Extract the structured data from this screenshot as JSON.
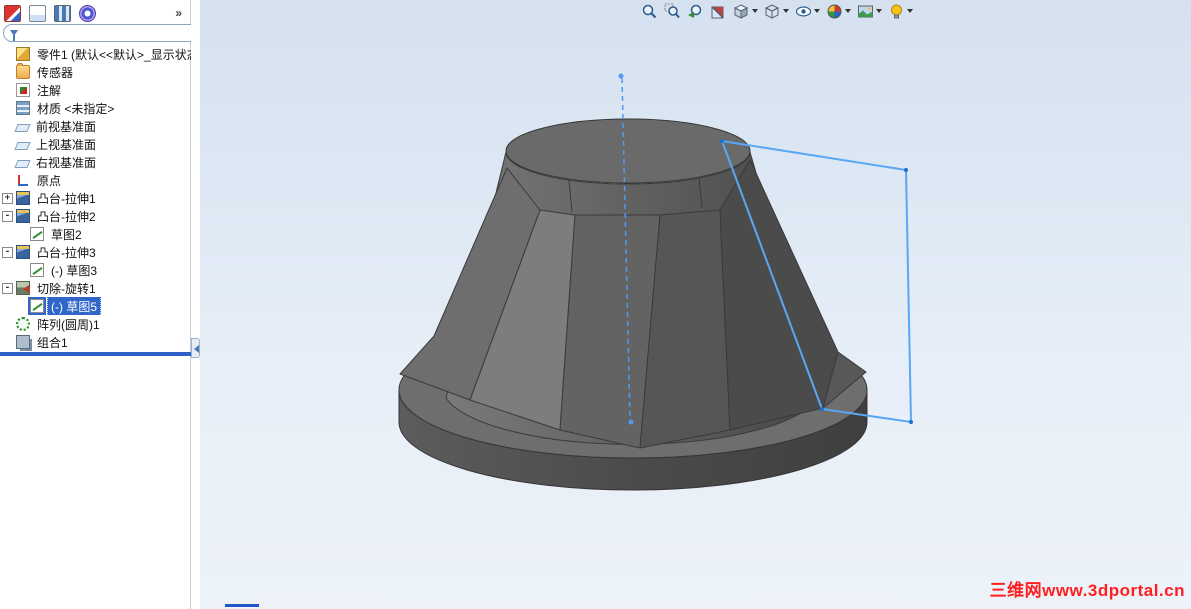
{
  "window": {
    "toolbar_overflow": "»"
  },
  "left_toolbar": {
    "icons": [
      "app-icon",
      "document-icon",
      "grid-icon",
      "axis-icon"
    ]
  },
  "feature_tree": {
    "filter_placeholder": "",
    "items": [
      {
        "label": "零件1  (默认<<默认>_显示状态",
        "icon": "part-icon",
        "expand": ""
      },
      {
        "label": "传感器",
        "icon": "sensors-folder-icon",
        "expand": ""
      },
      {
        "label": "注解",
        "icon": "annotations-folder-icon",
        "expand": ""
      },
      {
        "label": "材质 <未指定>",
        "icon": "material-icon",
        "expand": ""
      },
      {
        "label": "前视基准面",
        "icon": "plane-icon",
        "expand": ""
      },
      {
        "label": "上视基准面",
        "icon": "plane-icon",
        "expand": ""
      },
      {
        "label": "右视基准面",
        "icon": "plane-icon",
        "expand": ""
      },
      {
        "label": "原点",
        "icon": "origin-icon",
        "expand": ""
      },
      {
        "label": "凸台-拉伸1",
        "icon": "boss-extrude-icon",
        "expand": "+"
      },
      {
        "label": "凸台-拉伸2",
        "icon": "boss-extrude-icon",
        "expand": "-"
      },
      {
        "label": "草图2",
        "icon": "sketch-icon",
        "expand": ""
      },
      {
        "label": "凸台-拉伸3",
        "icon": "boss-extrude-icon",
        "expand": "-"
      },
      {
        "label": "(-) 草图3",
        "icon": "sketch-icon",
        "expand": ""
      },
      {
        "label": "切除-旋转1",
        "icon": "cut-revolve-icon",
        "expand": "-"
      },
      {
        "label": "(-) 草图5",
        "icon": "sketch-icon",
        "expand": "",
        "selected": true
      },
      {
        "label": "阵列(圆周)1",
        "icon": "circular-pattern-icon",
        "expand": ""
      },
      {
        "label": "组合1",
        "icon": "combine-icon",
        "expand": ""
      }
    ]
  },
  "viewport": {
    "hud_buttons": [
      "zoom-to-fit",
      "zoom-to-area",
      "previous-view",
      "section-view",
      "view-orientation",
      "display-style",
      "hide-show-items",
      "edit-appearance",
      "apply-scene",
      "view-settings"
    ],
    "watermark": "三维网www.3dportal.cn",
    "colors": {
      "sketch_blue": "#5aa7f5",
      "selection_blue": "#2f66c8",
      "watermark_red": "#ff1f1f",
      "model_gray": "#5f5f5f"
    }
  }
}
